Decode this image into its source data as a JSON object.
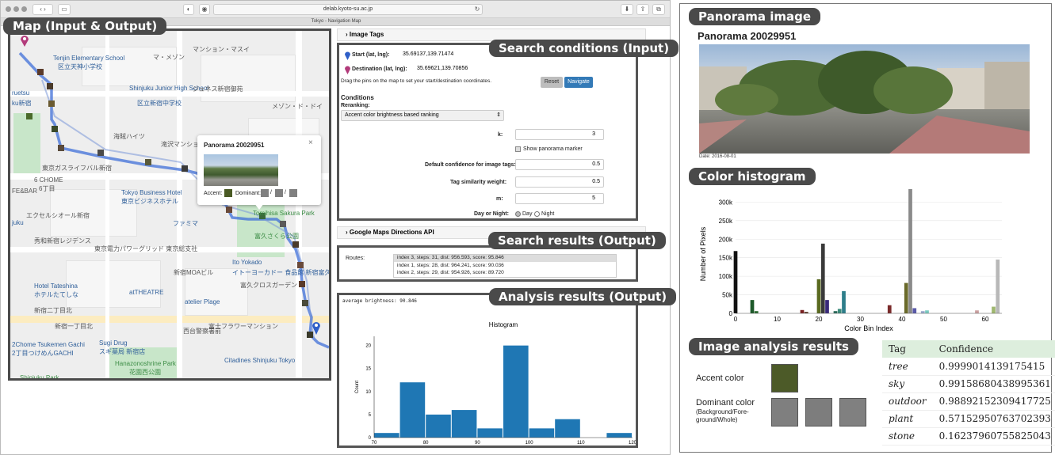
{
  "browser": {
    "url": "delab.kyoto-su.ac.jp",
    "tab_title": "Tokyo - Navigation Map"
  },
  "callouts": {
    "map": "Map (Input & Output)",
    "search_conditions": "Search conditions (Input)",
    "search_results": "Search results (Output)",
    "analysis_results": "Analysis results (Output)",
    "panorama_image": "Panorama image",
    "color_histogram": "Color histogram",
    "image_analysis": "Image analysis results"
  },
  "map": {
    "labels": {
      "tenjin": "Tenjin Elementary School",
      "tenjin_jp": "区立天神小学校",
      "masion": "マ・メゾン",
      "shinjuku_jh": "Shinjuku Junior High School",
      "shinjuku_jh_jp": "区立新宿中学校",
      "jeunesse": "ジュネス新宿御苑",
      "mansion_maison": "マンション・マスイ",
      "maison_dor": "メゾン・ド・ドイ",
      "kaiko": "海賊ハイツ",
      "takizawa": "滝沢マンション",
      "tokyo_business": "Tokyo Business Hotel",
      "tokyo_business_jp": "東京ビジネスホテル",
      "sgc": "東京ガスライフバル新宿",
      "chome6": "6 CHOME",
      "chome6_jp": "6丁目",
      "family": "ファミマ",
      "tomihisa": "Tomihisa Sakura Park",
      "tomihisa_jp": "富久さくら公園",
      "ito_yokado": "Ito Yokado",
      "ito_yokado_jp": "イトーヨーカドー 食品館 新宿富久店",
      "excel": "エクセルシオール新宿",
      "residence": "秀和新宿レジデンス",
      "mansion_tokyo": "東京電力パワーグリッド 東京総支社",
      "moa": "新宿MOAビル",
      "hotel_tateshina": "Hotel Tateshina",
      "hotel_tateshina_jp": "ホテルたてしな",
      "theatre": "atTHEATRE",
      "atelier": "atelier Plage",
      "shinjuku2": "新宿二丁目北",
      "shinjuku1": "新宿一丁目北",
      "sugi": "Sugi Drug",
      "sugi_jp": "スギ薬局 新宿店",
      "tsukemen": "2Chome Tsukemen Gachi",
      "tsukemen_jp": "2丁目つけめんGACHI",
      "hanazono": "Hanazonoshrine Park",
      "hanazono_jp": "花園西公園",
      "citadines": "Citadines Shinjuku Tokyo",
      "shinjuku_hospital": "新宿区",
      "kokuritsu": "西台警察署前",
      "kosshiro": "富久クロスガーデン",
      "shinjuku_park": "Shinjuku Park",
      "fe_bar": "FE&BAR",
      "aruetsu": "ruetsu",
      "uku": "ku新宿",
      "fuji": "富士フラワーマンション",
      "jikeido": "Jik",
      "ukuku": "juku"
    },
    "popup": {
      "title": "Panorama 20029951",
      "accent_label": "Accent:",
      "dominant_label": "Dominant:",
      "sep": "/",
      "accent_color": "#4a5a24",
      "dominant_color": "#808080"
    }
  },
  "search": {
    "image_tags_header": "Image Tags",
    "start_label": "Start (lat, lng):",
    "start_value": "35.69137,139.71474",
    "dest_label": "Destination (lat, lng):",
    "dest_value": "35.69621,139.70856",
    "hint": "Drag the pins on the map to set your start/destination coordinates.",
    "reset": "Reset",
    "navigate": "Navigate",
    "conditions": "Conditions",
    "reranking": "Reranking:",
    "reranking_value": "Accent color brightness based ranking",
    "k_label": "k:",
    "k_value": "3",
    "show_marker": "Show panorama marker",
    "confidence_label": "Default confidence for image tags:",
    "confidence_value": "0.5",
    "tag_sim_label": "Tag similarity weight:",
    "tag_sim_value": "0.5",
    "m_label": "m:",
    "m_value": "5",
    "day_night_label": "Day or Night:",
    "day": "Day",
    "night": "Night"
  },
  "results": {
    "google_header": "Google Maps Directions API",
    "routes_label": "Routes:",
    "routes": [
      "index 3, steps: 31, dist: 956.593, score: 95.846",
      "index 1, steps: 28, dist: 964.241, score: 90.036",
      "index 2, steps: 29, dist: 954.926, score: 89.720"
    ]
  },
  "analysis": {
    "avg_brightness": "average brightness: 90.846",
    "chart_title": "Histogram",
    "ylabel": "Count",
    "x_ticks": [
      "70",
      "80",
      "90",
      "100",
      "110",
      "120"
    ],
    "y_ticks": [
      "0",
      "5",
      "10",
      "15",
      "20"
    ]
  },
  "panorama": {
    "title": "Panorama 20029951",
    "date": "Date: 2016-08-01"
  },
  "color_hist": {
    "ylabel": "Number of Pixels",
    "xlabel": "Color Bin Index",
    "y_ticks": [
      "0",
      "50k",
      "100k",
      "150k",
      "200k",
      "250k",
      "300k"
    ],
    "x_ticks": [
      "0",
      "10",
      "20",
      "30",
      "40",
      "50",
      "60"
    ]
  },
  "image_analysis": {
    "accent_label": "Accent color",
    "dominant_label": "Dominant color",
    "dominant_sub": "(Background/Fore-ground/Whole)",
    "accent_color": "#4c5a28",
    "dominant_colors": [
      "#7f7f7f",
      "#7d7d7d",
      "#808080"
    ],
    "tag_header": "Tag",
    "confidence_header": "Confidence",
    "tags": [
      {
        "tag": "tree",
        "conf": "0.9999014139175415"
      },
      {
        "tag": "sky",
        "conf": "0.99158680438995361"
      },
      {
        "tag": "outdoor",
        "conf": "0.98892152309417725"
      },
      {
        "tag": "plant",
        "conf": "0.57152950763702393"
      },
      {
        "tag": "stone",
        "conf": "0.16237960755825043"
      }
    ]
  },
  "chart_data": [
    {
      "type": "bar",
      "title": "Histogram",
      "xlabel": "",
      "ylabel": "Count",
      "bin_edges": [
        70,
        75,
        80,
        85,
        90,
        95,
        100,
        105,
        110,
        115,
        120
      ],
      "values": [
        1,
        12,
        5,
        6,
        2,
        20,
        2,
        4,
        0,
        1
      ],
      "xlim": [
        70,
        120
      ],
      "ylim": [
        0,
        22
      ],
      "color": "#1f77b4"
    },
    {
      "type": "bar",
      "title": "",
      "xlabel": "Color Bin Index",
      "ylabel": "Number of Pixels",
      "xlim": [
        0,
        64
      ],
      "ylim": [
        0,
        320000
      ],
      "bars": [
        {
          "x": 0,
          "value": 168000,
          "color": "#111111"
        },
        {
          "x": 4,
          "value": 36000,
          "color": "#1e5a2a"
        },
        {
          "x": 5,
          "value": 6000,
          "color": "#2a6a30"
        },
        {
          "x": 16,
          "value": 9000,
          "color": "#7a2020"
        },
        {
          "x": 17,
          "value": 4000,
          "color": "#5a3a2a"
        },
        {
          "x": 20,
          "value": 92000,
          "color": "#5a6a20"
        },
        {
          "x": 21,
          "value": 188000,
          "color": "#3a3a3a"
        },
        {
          "x": 22,
          "value": 36000,
          "color": "#3a2a7a"
        },
        {
          "x": 24,
          "value": 6000,
          "color": "#2a6a5a"
        },
        {
          "x": 25,
          "value": 12000,
          "color": "#3a8a7a"
        },
        {
          "x": 26,
          "value": 60000,
          "color": "#2e7e8a"
        },
        {
          "x": 37,
          "value": 22000,
          "color": "#7a2a2a"
        },
        {
          "x": 41,
          "value": 82000,
          "color": "#6a6a2a"
        },
        {
          "x": 42,
          "value": 335000,
          "color": "#8a8a8a"
        },
        {
          "x": 43,
          "value": 14000,
          "color": "#5a5aaa"
        },
        {
          "x": 45,
          "value": 6000,
          "color": "#9aaacc"
        },
        {
          "x": 46,
          "value": 8000,
          "color": "#7acac0"
        },
        {
          "x": 58,
          "value": 8000,
          "color": "#caa0a0"
        },
        {
          "x": 62,
          "value": 18000,
          "color": "#a0b870"
        },
        {
          "x": 63,
          "value": 145000,
          "color": "#b8b8b8"
        }
      ]
    }
  ]
}
